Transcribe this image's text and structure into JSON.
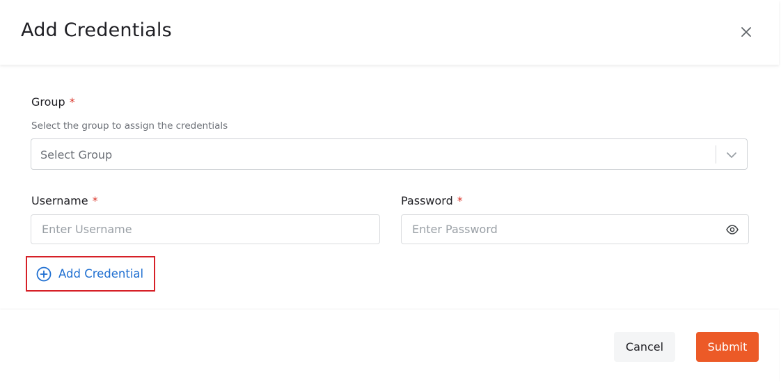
{
  "dialog": {
    "title": "Add Credentials",
    "close_icon": "close-icon"
  },
  "group": {
    "label": "Group",
    "required_marker": "*",
    "help": "Select the group to assign the credentials",
    "placeholder": "Select Group",
    "chevron_icon": "chevron-down-icon"
  },
  "username": {
    "label": "Username",
    "required_marker": "*",
    "placeholder": "Enter Username"
  },
  "password": {
    "label": "Password",
    "required_marker": "*",
    "placeholder": "Enter Password",
    "toggle_icon": "eye-icon"
  },
  "add_credential": {
    "label": "Add Credential",
    "icon": "plus-circle-icon"
  },
  "footer": {
    "cancel_label": "Cancel",
    "submit_label": "Submit"
  },
  "colors": {
    "accent_blue": "#1f6fd1",
    "submit_orange": "#ec5a27",
    "required_red": "#d93025",
    "highlight_red": "#d62027"
  }
}
